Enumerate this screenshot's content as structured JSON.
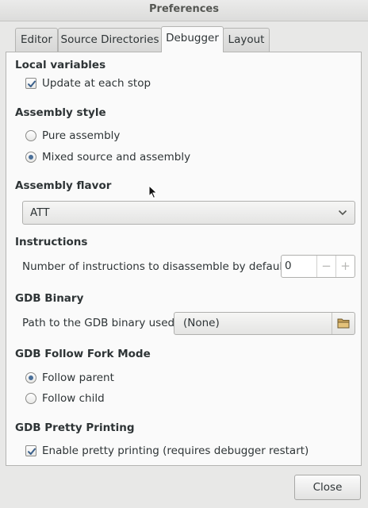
{
  "window": {
    "title": "Preferences"
  },
  "tabs": [
    {
      "label": "Editor"
    },
    {
      "label": "Source Directories"
    },
    {
      "label": "Debugger"
    },
    {
      "label": "Layout"
    }
  ],
  "local_variables": {
    "title": "Local variables",
    "update_each_stop": {
      "label": "Update at each stop",
      "checked": true
    }
  },
  "assembly_style": {
    "title": "Assembly style",
    "options": [
      {
        "label": "Pure assembly",
        "selected": false
      },
      {
        "label": "Mixed source and assembly",
        "selected": true
      }
    ]
  },
  "assembly_flavor": {
    "title": "Assembly flavor",
    "value": "ATT"
  },
  "instructions": {
    "title": "Instructions",
    "label": "Number of instructions to disassemble by default",
    "value": "0",
    "decrement": "−",
    "increment": "+"
  },
  "gdb_binary": {
    "title": "GDB Binary",
    "label": "Path to the GDB binary used",
    "value": "(None)",
    "icon": "folder-icon"
  },
  "fork_mode": {
    "title": "GDB Follow Fork Mode",
    "options": [
      {
        "label": "Follow parent",
        "selected": true
      },
      {
        "label": "Follow child",
        "selected": false
      }
    ]
  },
  "pretty_printing": {
    "title": "GDB Pretty Printing",
    "enable": {
      "label": "Enable pretty printing (requires debugger restart)",
      "checked": true
    }
  },
  "buttons": {
    "close": "Close"
  },
  "colors": {
    "accent": "#4a6f99",
    "background": "#e8e8e7",
    "panel": "#fafafa"
  }
}
